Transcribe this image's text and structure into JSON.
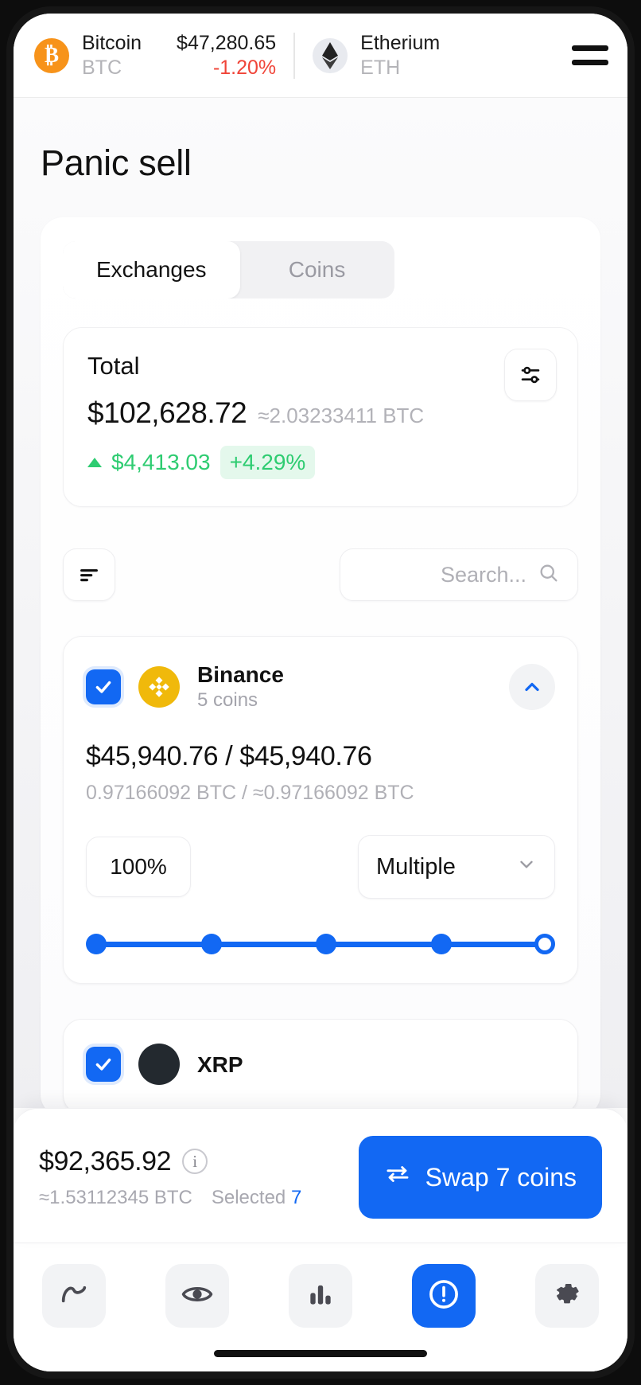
{
  "ticker": {
    "coins": [
      {
        "name": "Bitcoin",
        "symbol": "BTC",
        "price": "$47,280.65",
        "change": "-1.20%",
        "logo": "bitcoin-icon"
      },
      {
        "name": "Etherium",
        "symbol": "ETH",
        "price": "",
        "change": "",
        "logo": "ethereum-icon"
      }
    ],
    "menu_icon": "hamburger-menu-icon"
  },
  "page": {
    "title": "Panic sell"
  },
  "tabs": [
    {
      "label": "Exchanges",
      "active": true
    },
    {
      "label": "Coins",
      "active": false
    }
  ],
  "total": {
    "label": "Total",
    "amount": "$102,628.72",
    "btc": "≈2.03233411 BTC",
    "delta_value": "$4,413.03",
    "delta_pct": "+4.29%",
    "delta_direction": "up",
    "settings_icon": "sliders-icon"
  },
  "toolbar": {
    "sort_icon": "sort-icon",
    "search_placeholder": "Search...",
    "search_value": "",
    "search_icon": "search-icon"
  },
  "exchanges": [
    {
      "name": "Binance",
      "coins_label": "5 coins",
      "logo": "binance-icon",
      "checked": true,
      "expanded": true,
      "collapse_icon": "chevron-up-icon",
      "amount": "$45,940.76 / $45,940.76",
      "btc": "0.97166092 BTC / ≈0.97166092 BTC",
      "percent": "100%",
      "mode": "Multiple",
      "mode_chevron": "chevron-down-icon",
      "slider": {
        "value": 100,
        "stops": [
          0,
          25,
          50,
          75,
          100
        ]
      }
    },
    {
      "name": "XRP",
      "logo": "xrp-icon",
      "checked": true
    }
  ],
  "summary": {
    "amount": "$92,365.92",
    "info_icon": "info-icon",
    "btc": "≈1.53112345 BTC",
    "selected_label": "Selected",
    "selected_count": "7",
    "swap_label": "Swap 7 coins",
    "swap_icon": "swap-arrows-icon"
  },
  "navbar": [
    {
      "name": "activity",
      "icon": "pulse-icon",
      "active": false
    },
    {
      "name": "watchlist",
      "icon": "eye-icon",
      "active": false
    },
    {
      "name": "stats",
      "icon": "bar-chart-icon",
      "active": false
    },
    {
      "name": "panic",
      "icon": "alert-circle-icon",
      "active": true
    },
    {
      "name": "settings",
      "icon": "gear-icon",
      "active": false
    }
  ],
  "colors": {
    "accent": "#1268f3",
    "positive": "#2ecc71",
    "negative": "#f04438",
    "bitcoin": "#f7931a",
    "binance": "#f0b90b"
  }
}
